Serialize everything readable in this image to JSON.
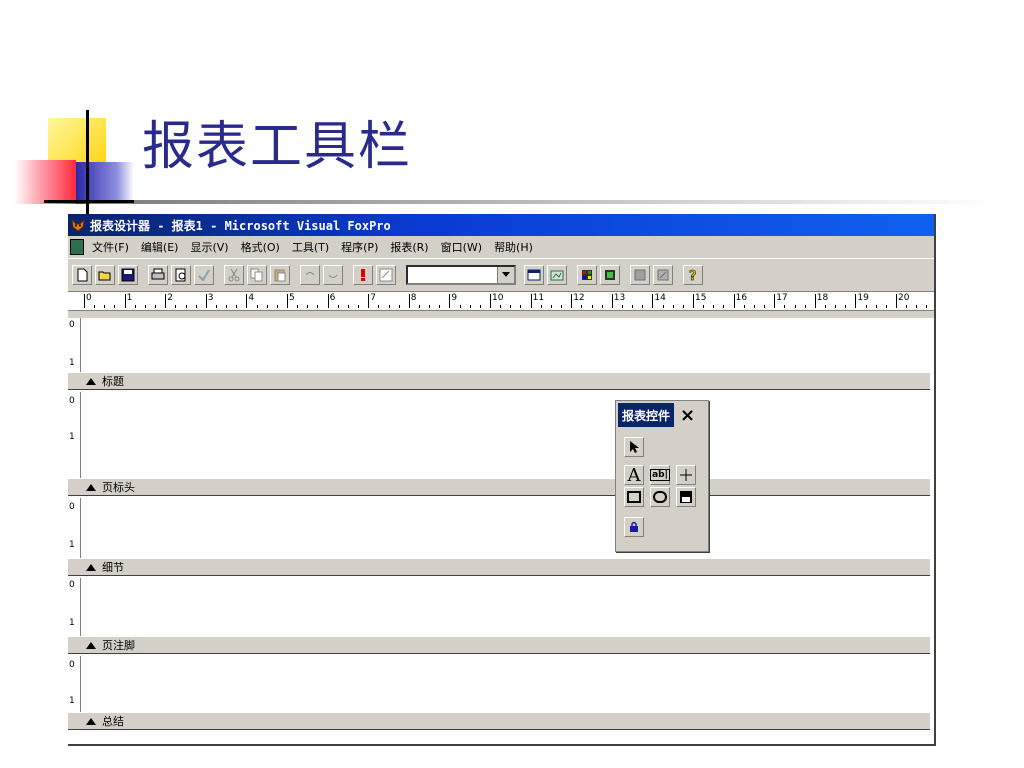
{
  "slide": {
    "title": "报表工具栏"
  },
  "window": {
    "title": "报表设计器 - 报表1 - Microsoft Visual FoxPro",
    "menu": [
      "文件(F)",
      "编辑(E)",
      "显示(V)",
      "格式(O)",
      "工具(T)",
      "程序(P)",
      "报表(R)",
      "窗口(W)",
      "帮助(H)"
    ],
    "toolbar_icons": [
      "new-icon",
      "open-icon",
      "save-icon",
      "print-icon",
      "print-preview-icon",
      "spell-check-icon",
      "cut-icon",
      "copy-icon",
      "paste-icon",
      "undo-icon",
      "redo-icon",
      "run-icon",
      "modify-icon",
      "data-environment-icon",
      "report-controls-icon",
      "color-palette-icon",
      "layout-icon",
      "form-icon",
      "builder-icon",
      "help-icon"
    ],
    "ruler_numbers": [
      "0",
      "1",
      "2",
      "3",
      "4",
      "5",
      "6",
      "7",
      "8",
      "9",
      "10",
      "11",
      "12",
      "13",
      "14",
      "15",
      "16",
      "17",
      "18",
      "19",
      "20"
    ],
    "vruler_marks": [
      "0",
      "1"
    ],
    "bands": [
      {
        "label": "标题"
      },
      {
        "label": "页标头"
      },
      {
        "label": "细节"
      },
      {
        "label": "页注脚"
      },
      {
        "label": "总结"
      }
    ]
  },
  "palette": {
    "title": "报表控件",
    "close": "×",
    "buttons": [
      "select-pointer-icon",
      "label-icon",
      "field-icon",
      "line-icon",
      "rectangle-icon",
      "rounded-rectangle-icon",
      "picture-ole-icon",
      "button-lock-icon"
    ],
    "label_glyph": "A",
    "field_glyph": "ab|"
  }
}
